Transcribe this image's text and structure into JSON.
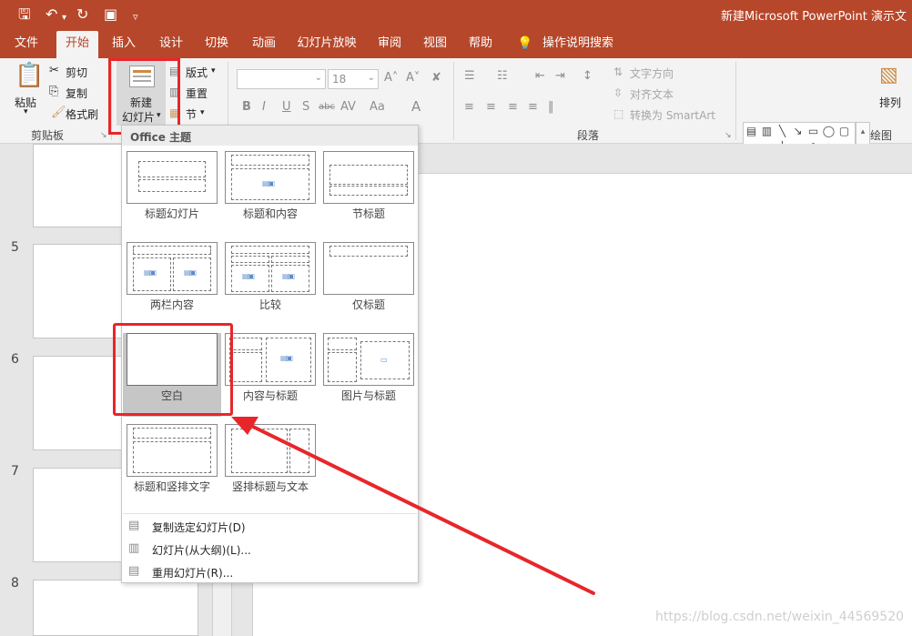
{
  "window": {
    "title": "新建Microsoft PowerPoint 演示文"
  },
  "quick_access": {
    "save_icon": "save-icon",
    "undo_icon": "undo-icon",
    "redo_icon": "redo-icon",
    "present_icon": "present-from-start-icon",
    "customize_icon": "customize-qat-icon"
  },
  "tabs": [
    {
      "label": "文件"
    },
    {
      "label": "开始"
    },
    {
      "label": "插入"
    },
    {
      "label": "设计"
    },
    {
      "label": "切换"
    },
    {
      "label": "动画"
    },
    {
      "label": "幻灯片放映"
    },
    {
      "label": "审阅"
    },
    {
      "label": "视图"
    },
    {
      "label": "帮助"
    },
    {
      "label": "操作说明搜索"
    }
  ],
  "ribbon": {
    "clipboard": {
      "paste": "粘贴",
      "cut": "剪切",
      "copy": "复制",
      "format_painter": "格式刷",
      "group_label": "剪贴板"
    },
    "slides": {
      "new_slide_line1": "新建",
      "new_slide_line2": "幻灯片",
      "layout": "版式",
      "reset": "重置",
      "section": "节"
    },
    "font": {
      "font_size": "18",
      "bold": "B",
      "italic": "I",
      "underline": "U",
      "shadow": "S",
      "strike": "abc",
      "spacing": "AV",
      "case": "Aa",
      "color": "A"
    },
    "paragraph": {
      "text_direction": "文字方向",
      "align_text": "对齐文本",
      "convert_smartart": "转换为 SmartArt",
      "group_label": "段落"
    },
    "drawing": {
      "arrange": "排列",
      "group_label": "绘图"
    }
  },
  "slide_numbers": [
    "5",
    "6",
    "7",
    "8"
  ],
  "dropdown": {
    "header": "Office 主题",
    "layouts": [
      {
        "name": "标题幻灯片"
      },
      {
        "name": "标题和内容"
      },
      {
        "name": "节标题"
      },
      {
        "name": "两栏内容"
      },
      {
        "name": "比较"
      },
      {
        "name": "仅标题"
      },
      {
        "name": "空白"
      },
      {
        "name": "内容与标题"
      },
      {
        "name": "图片与标题"
      },
      {
        "name": "标题和竖排文字"
      },
      {
        "name": "竖排标题与文本"
      }
    ],
    "selected_layout": "空白",
    "commands": [
      {
        "label": "复制选定幻灯片(D)"
      },
      {
        "label": "幻灯片(从大纲)(L)..."
      },
      {
        "label": "重用幻灯片(R)..."
      }
    ]
  },
  "watermark": "https://blog.csdn.net/weixin_44569520",
  "colors": {
    "accent": "#b7472a",
    "annotation": "#e8262a"
  }
}
